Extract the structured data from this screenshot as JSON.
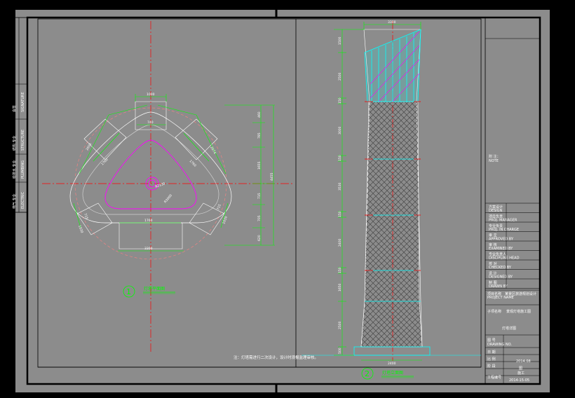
{
  "colors": {
    "background": "#000000",
    "sheet": "#8c8c8c",
    "frame": "#000000",
    "dimension": "#00ff00",
    "centerline": "#ff0000",
    "cyan": "#00ffff",
    "magenta": "#ff00ff",
    "pink": "#ff8080",
    "white": "#ffffff"
  },
  "plan": {
    "dims_top": [
      "1000",
      "740"
    ],
    "dims_left": [
      "2605",
      "1760",
      "715",
      "1030"
    ],
    "dims_right": [
      "2074",
      "1760",
      "R2130",
      "R3000",
      "715",
      "1030"
    ],
    "dims_bottom": [
      "1760",
      "3300"
    ],
    "dims_vertical": [
      "460",
      "785",
      "1655",
      "4455",
      "715",
      "705",
      "620"
    ],
    "label_number": "1",
    "label_title": "灯塔平面图"
  },
  "elevation": {
    "dim_top": "3300",
    "dim_bottom": "2400",
    "dims_left": [
      "1500",
      "2500",
      "150",
      "3000",
      "150",
      "3530",
      "150",
      "2400",
      "150",
      "1650",
      "2500",
      "500"
    ],
    "label_number": "2",
    "label_title": "灯塔立面图"
  },
  "note": "注：灯塔需进行二次设计，设计时须报监理审核。",
  "left_strip": {
    "rows": [
      {
        "label": "会签",
        "sub": "SIGNATURE"
      },
      {
        "label": "结构 专业",
        "sub": "STRUCTURE"
      },
      {
        "label": "给排水 专业",
        "sub": "PLUMBING"
      },
      {
        "label": "电气 专业",
        "sub": "ELECTRIC"
      }
    ]
  },
  "title_block": {
    "remarks": "附 注：",
    "remarks_sub": "NOTE",
    "rows": [
      {
        "label": "方案设计",
        "sub": "DESIGN"
      },
      {
        "label": "项目负责",
        "sub": "PROJ. MANAGER"
      },
      {
        "label": "专业负责",
        "sub": "PROJ. IN CHARGE"
      },
      {
        "label": "审 定",
        "sub": "APPROVED BY"
      },
      {
        "label": "审 核",
        "sub": "EXAMINED BY"
      },
      {
        "label": "专业负责人",
        "sub": "DISCIPLINE HEAD"
      },
      {
        "label": "校 对",
        "sub": "CHECKED BY"
      },
      {
        "label": "设 计",
        "sub": "DESIGNED BY"
      },
      {
        "label": "制 图",
        "sub": "DRAWN BY"
      }
    ],
    "project_label": "项目名称",
    "project_sub": "PROJECT NAME",
    "project_name": "某景区旅游规划设计",
    "sub_project_label": "子项名称",
    "sub_project_name": "景观灯塔施工图",
    "drawing_title": "灯塔详图",
    "drawing_no_label": "图 号",
    "drawing_no_sub": "DRAWING NO.",
    "date_label": "日 期",
    "date_value": "2014.08",
    "scale_label": "比 例",
    "scale_value": "图",
    "phase_label": "阶 段",
    "phase_value": "施工",
    "project_no_label": "工程编号",
    "project_no_value": "2014-15-05"
  }
}
